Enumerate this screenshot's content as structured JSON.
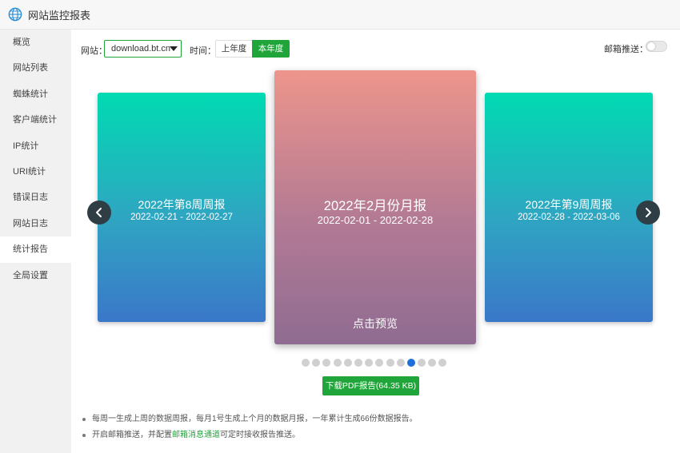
{
  "app": {
    "title": "网站监控报表",
    "icon": "globe-icon"
  },
  "sidebar": {
    "items": [
      {
        "label": "概览"
      },
      {
        "label": "网站列表"
      },
      {
        "label": "蜘蛛统计"
      },
      {
        "label": "客户端统计"
      },
      {
        "label": "IP统计"
      },
      {
        "label": "URI统计"
      },
      {
        "label": "错误日志"
      },
      {
        "label": "网站日志"
      },
      {
        "label": "统计报告",
        "active": true
      },
      {
        "label": "全局设置"
      }
    ]
  },
  "toolbar": {
    "site_label": "网站：",
    "site_value": "download.bt.cn",
    "time_label": "时间：",
    "last_year": "上年度",
    "this_year": "本年度",
    "email_label": "邮箱推送：",
    "email_enabled": false
  },
  "carousel": {
    "cards": [
      {
        "title": "2022年第8周周报",
        "range": "2022-02-21 - 2022-02-27"
      },
      {
        "title": "2022年2月份月报",
        "range": "2022-02-01 - 2022-02-28",
        "preview": "点击预览"
      },
      {
        "title": "2022年第9周周报",
        "range": "2022-02-28 - 2022-03-06"
      }
    ],
    "dot_count": 14,
    "active_dot": 10,
    "colors": {
      "side_top": "#00dbb2",
      "side_bottom": "#3a77c9",
      "center_top": "#ed958b",
      "center_bottom": "#8f6c92"
    }
  },
  "download": {
    "label": "下载PDF报告(64.35 KB)"
  },
  "notes": {
    "line1": "每周一生成上周的数据周报，每月1号生成上个月的数据月报，一年累计生成66份数据报告。",
    "line2_pre": "开启邮箱推送，并配置",
    "line2_link": "邮箱消息通道",
    "line2_post": "可定时接收报告推送。"
  },
  "colors": {
    "accent": "#20a53a",
    "active_dot": "#1e6fd9"
  }
}
